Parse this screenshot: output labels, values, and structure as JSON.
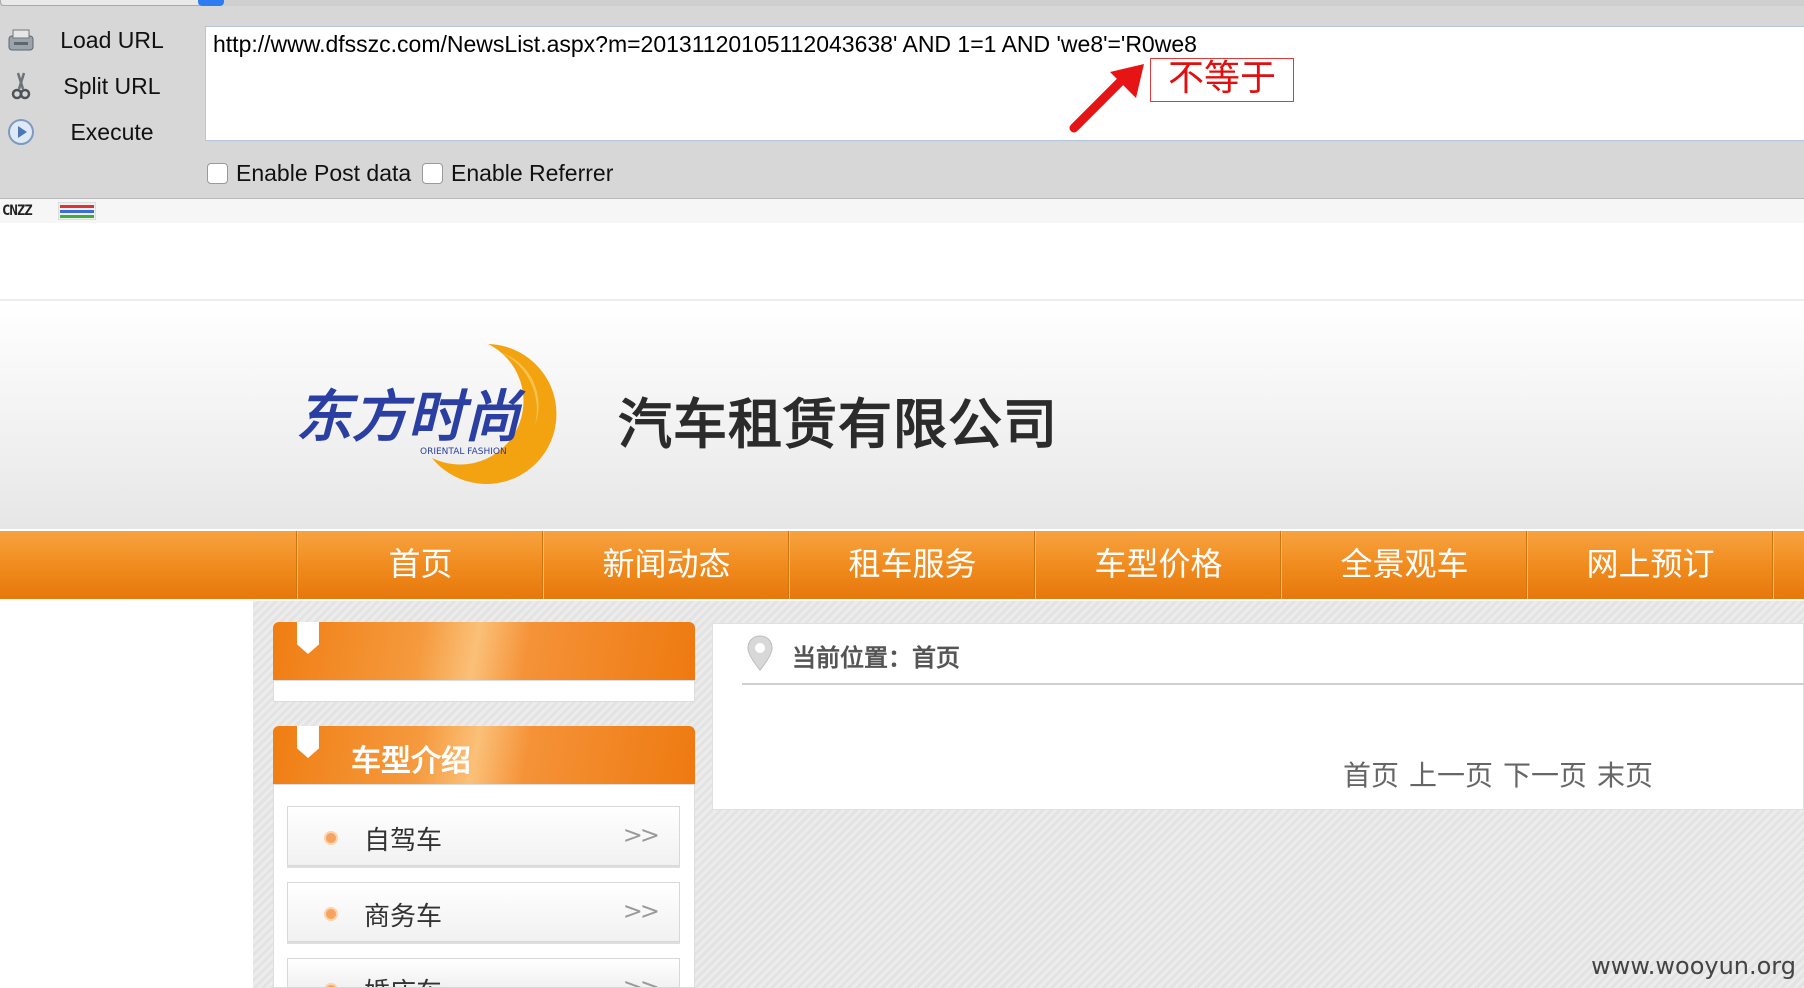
{
  "hackbar": {
    "actions": [
      {
        "label": "Load URL",
        "icon": "load-url-icon"
      },
      {
        "label": "Split URL",
        "icon": "scissors-icon"
      },
      {
        "label": "Execute",
        "icon": "play-icon"
      }
    ],
    "url_value": "http://www.dfsszc.com/NewsList.aspx?m=20131120105112043638' AND 1=1 AND 'we8'='R0we8",
    "checkboxes": [
      {
        "label": "Enable Post data",
        "checked": false
      },
      {
        "label": "Enable Referrer",
        "checked": false
      }
    ]
  },
  "annotation": {
    "label": "不等于",
    "color": "#e01010"
  },
  "cnzz": {
    "label": "CNZZ"
  },
  "site": {
    "logo": {
      "brand": "东方时尚",
      "brand_en": "ORIENTAL FASHION"
    },
    "company_name": "汽车租赁有限公司",
    "nav": [
      "首页",
      "新闻动态",
      "租车服务",
      "车型价格",
      "全景观车",
      "网上预订"
    ],
    "accent_color": "#f08a1c",
    "sidebar": {
      "panel1_title": "",
      "panel2_title": "车型介绍",
      "categories": [
        "自驾车",
        "商务车",
        "婚庆车"
      ],
      "chevron": ">>"
    },
    "main": {
      "breadcrumb": "当前位置：首页",
      "pagination": [
        "首页",
        "上一页",
        "下一页",
        "末页"
      ]
    }
  },
  "watermark": "www.wooyun.org"
}
